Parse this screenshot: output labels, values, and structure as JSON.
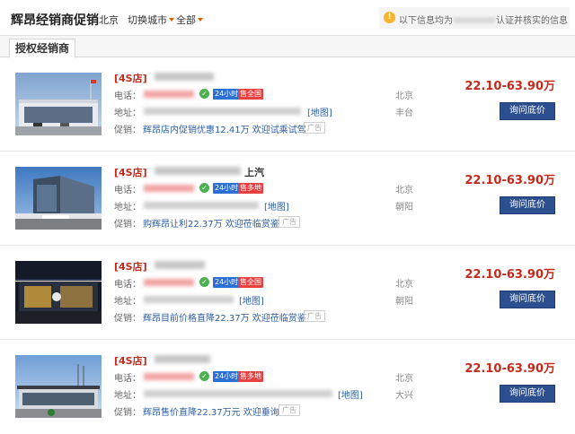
{
  "header": {
    "title": "辉昂经销商促销",
    "city": "北京",
    "switch_city": "切换城市",
    "scope": "全部",
    "notice_prefix": "以下信息均为",
    "notice_suffix": "认证并核实的信息"
  },
  "tabs": [
    {
      "label": "授权经销商"
    }
  ],
  "labels": {
    "type_tag": "[4S店]",
    "phone": "电话：",
    "address": "地址：",
    "promo": "促销：",
    "map": "[地图]",
    "ad": "广告",
    "hours_badge": "24小时",
    "cta": "询问底价"
  },
  "colors": {
    "price": "#c42a1c",
    "link": "#2b5fa8",
    "button": "#2c4f8f"
  },
  "dealers": [
    {
      "name_suffix": "",
      "coverage_badge": "售全国",
      "promo": "辉昂店内促销优惠12.41万 欢迎试乘试驾",
      "city": "北京",
      "district": "丰台",
      "price": "22.10-63.90万"
    },
    {
      "name_suffix": "上汽",
      "coverage_badge": "售多地",
      "promo": "购辉昂让利22.37万 欢迎莅临赏鉴",
      "city": "北京",
      "district": "朝阳",
      "price": "22.10-63.90万"
    },
    {
      "name_suffix": "",
      "coverage_badge": "售全国",
      "promo": "辉昂目前价格直降22.37万 欢迎莅临赏鉴",
      "city": "北京",
      "district": "朝阳",
      "price": "22.10-63.90万"
    },
    {
      "name_suffix": "",
      "coverage_badge": "售多地",
      "promo": "辉昂售价直降22.37万元 欢迎垂询",
      "city": "北京",
      "district": "大兴",
      "price": "22.10-63.90万"
    }
  ]
}
